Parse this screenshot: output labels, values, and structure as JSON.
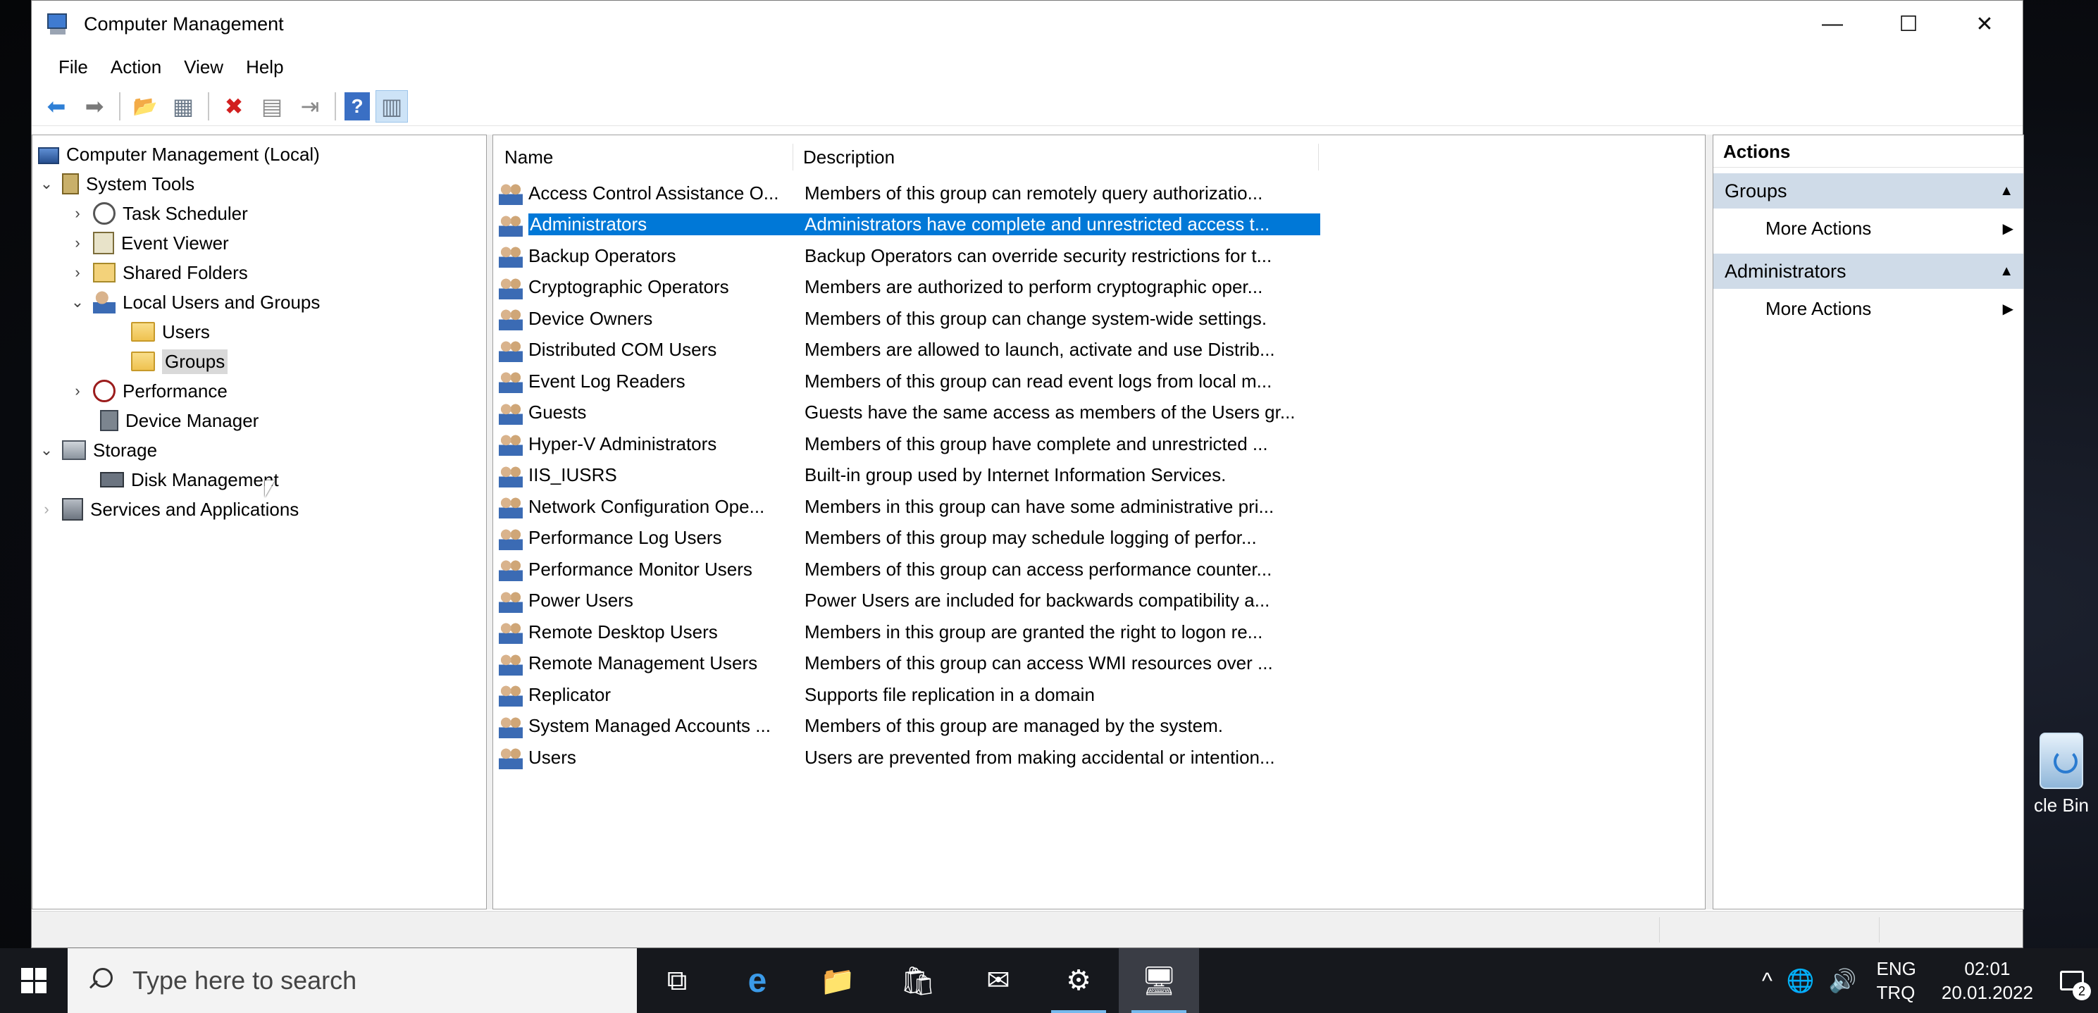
{
  "window": {
    "title": "Computer Management",
    "controls": {
      "minimize": "—",
      "maximize": "☐",
      "close": "✕"
    }
  },
  "menu": [
    "File",
    "Action",
    "View",
    "Help"
  ],
  "toolbar": [
    {
      "icon": "back-arrow-icon",
      "glyph": "⬅"
    },
    {
      "icon": "forward-arrow-icon",
      "glyph": "➡"
    },
    {
      "icon": "up-folder-icon",
      "glyph": "📂"
    },
    {
      "icon": "show-hide-console-tree-icon",
      "glyph": "▦"
    },
    {
      "icon": "delete-icon",
      "glyph": "✖"
    },
    {
      "icon": "properties-icon",
      "glyph": "▤"
    },
    {
      "icon": "export-list-icon",
      "glyph": "⇥"
    },
    {
      "icon": "help-icon",
      "glyph": "?"
    },
    {
      "icon": "show-action-pane-icon",
      "glyph": "▥"
    }
  ],
  "tree": {
    "root": "Computer Management (Local)",
    "system_tools": "System Tools",
    "task_scheduler": "Task Scheduler",
    "event_viewer": "Event Viewer",
    "shared_folders": "Shared Folders",
    "local_users_groups": "Local Users and Groups",
    "users": "Users",
    "groups": "Groups",
    "performance": "Performance",
    "device_manager": "Device Manager",
    "storage": "Storage",
    "disk_management": "Disk Management",
    "services_apps": "Services and Applications"
  },
  "list": {
    "columns": {
      "name": "Name",
      "description": "Description"
    },
    "rows": [
      {
        "name": "Access Control Assistance O...",
        "description": "Members of this group can remotely query authorizatio..."
      },
      {
        "name": "Administrators",
        "description": "Administrators have complete and unrestricted access t..."
      },
      {
        "name": "Backup Operators",
        "description": "Backup Operators can override security restrictions for t..."
      },
      {
        "name": "Cryptographic Operators",
        "description": "Members are authorized to perform cryptographic oper..."
      },
      {
        "name": "Device Owners",
        "description": "Members of this group can change system-wide settings."
      },
      {
        "name": "Distributed COM Users",
        "description": "Members are allowed to launch, activate and use Distrib..."
      },
      {
        "name": "Event Log Readers",
        "description": "Members of this group can read event logs from local m..."
      },
      {
        "name": "Guests",
        "description": "Guests have the same access as members of the Users gr..."
      },
      {
        "name": "Hyper-V Administrators",
        "description": "Members of this group have complete and unrestricted ..."
      },
      {
        "name": "IIS_IUSRS",
        "description": "Built-in group used by Internet Information Services."
      },
      {
        "name": "Network Configuration Ope...",
        "description": "Members in this group can have some administrative pri..."
      },
      {
        "name": "Performance Log Users",
        "description": "Members of this group may schedule logging of perfor..."
      },
      {
        "name": "Performance Monitor Users",
        "description": "Members of this group can access performance counter..."
      },
      {
        "name": "Power Users",
        "description": "Power Users are included for backwards compatibility a..."
      },
      {
        "name": "Remote Desktop Users",
        "description": "Members in this group are granted the right to logon re..."
      },
      {
        "name": "Remote Management Users",
        "description": "Members of this group can access WMI resources over ..."
      },
      {
        "name": "Replicator",
        "description": "Supports file replication in a domain"
      },
      {
        "name": "System Managed Accounts ...",
        "description": "Members of this group are managed by the system."
      },
      {
        "name": "Users",
        "description": "Users are prevented from making accidental or intention..."
      }
    ],
    "selected_index": 1
  },
  "actions": {
    "title": "Actions",
    "sections": [
      {
        "header": "Groups",
        "item": "More Actions"
      },
      {
        "header": "Administrators",
        "item": "More Actions"
      }
    ]
  },
  "desktop": {
    "recycle_bin": "cle Bin"
  },
  "taskbar": {
    "search_placeholder": "Type here to search",
    "apps": [
      {
        "icon": "task-view-icon",
        "glyph": "⧉"
      },
      {
        "icon": "edge-browser-icon",
        "glyph": "e"
      },
      {
        "icon": "file-explorer-icon",
        "glyph": "📁"
      },
      {
        "icon": "microsoft-store-icon",
        "glyph": "🛍"
      },
      {
        "icon": "mail-icon",
        "glyph": "✉"
      },
      {
        "icon": "settings-gear-icon",
        "glyph": "⚙"
      },
      {
        "icon": "computer-management-icon",
        "glyph": "🖥"
      }
    ],
    "tray": {
      "chevron": "^",
      "network": "🌐",
      "volume": "🔊",
      "lang1": "ENG",
      "lang2": "TRQ",
      "time": "02:01",
      "date": "20.01.2022",
      "notif_count": "2"
    }
  }
}
